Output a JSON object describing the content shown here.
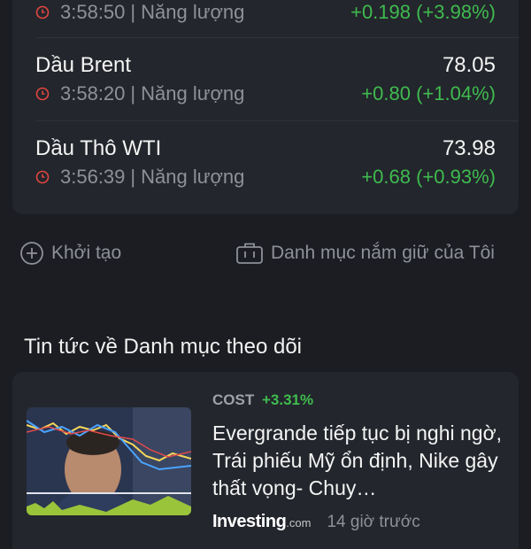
{
  "watchlist": {
    "rows": [
      {
        "name": "",
        "price": "",
        "time": "3:58:50",
        "category": "Năng lượng",
        "change": "+0.198 (+3.98%)"
      },
      {
        "name": "Dầu Brent",
        "price": "78.05",
        "time": "3:58:20",
        "category": "Năng lượng",
        "change": "+0.80 (+1.04%)"
      },
      {
        "name": "Dầu Thô WTI",
        "price": "73.98",
        "time": "3:56:39",
        "category": "Năng lượng",
        "change": "+0.68 (+0.93%)"
      }
    ],
    "separator": "|"
  },
  "actions": {
    "create_label": "Khởi tạo",
    "holdings_label": "Danh mục nắm giữ của Tôi"
  },
  "news_section": {
    "title": "Tin tức về Danh mục theo dõi",
    "items": [
      {
        "symbol": "COST",
        "change_pct": "+3.31%",
        "headline": "Evergrande tiếp tục bị nghi ngờ, Trái phiếu Mỹ ổn định, Nike gây thất vọng- Chuy…",
        "source_brand": "Investing",
        "source_suffix": ".com",
        "time_ago": "14 giờ trước"
      }
    ]
  },
  "colors": {
    "background": "#1b1d22",
    "card": "#23262c",
    "positive": "#3fbb4f",
    "muted": "#8e9199",
    "clock_red": "#e0473f"
  },
  "icons": [
    "clock-icon",
    "plus-circle-icon",
    "briefcase-icon"
  ]
}
